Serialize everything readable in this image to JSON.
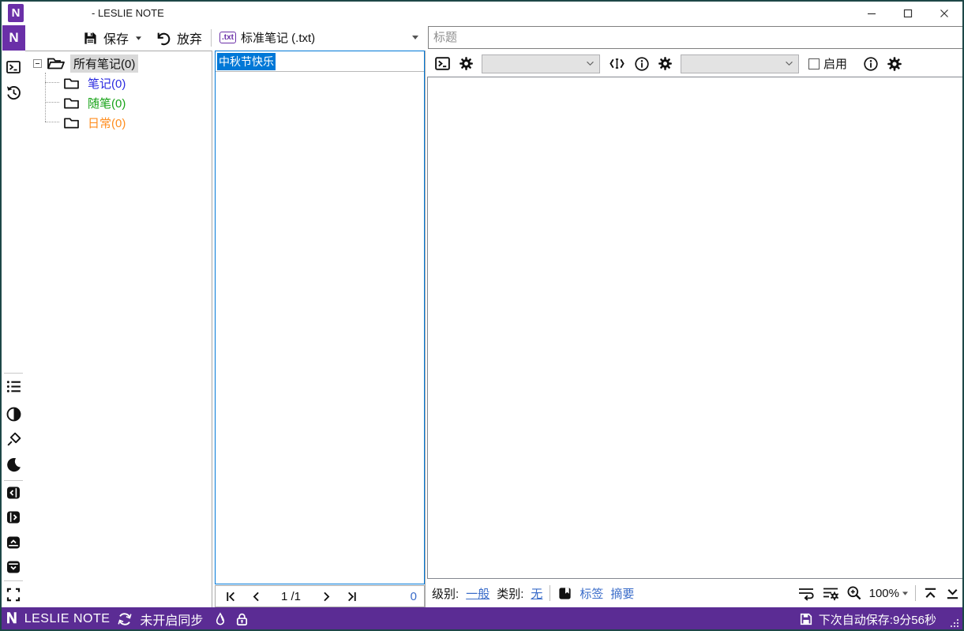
{
  "window": {
    "title": "- LESLIE NOTE"
  },
  "colors": {
    "accent_purple": "#6a2fa8",
    "statusbar_purple": "#5b2c94",
    "selection_blue": "#0078d7",
    "link_blue": "#3a6cc9",
    "folder_blue": "#2a2ae0",
    "folder_green": "#17a317",
    "folder_orange": "#ff8d1e"
  },
  "toolbar": {
    "save_label": "保存",
    "discard_label": "放弃",
    "note_type_label": "标准笔记 (.txt)",
    "txt_badge": ".txt"
  },
  "tree": {
    "items": [
      {
        "label": "所有笔记(0)"
      },
      {
        "label": "笔记(0)"
      },
      {
        "label": "随笔(0)"
      },
      {
        "label": "日常(0)"
      }
    ]
  },
  "note_list": {
    "selected_title": "中秋节快乐",
    "page_display": "1 /1",
    "count": "0"
  },
  "editor": {
    "title_placeholder": "标题",
    "enable_label": "启用"
  },
  "editor_footer": {
    "level_label": "级别:",
    "level_value": "一般",
    "category_label": "类别:",
    "category_value": "无",
    "tags_label": "标签",
    "summary_label": "摘要",
    "zoom_value": "100%"
  },
  "statusbar": {
    "logo_letter": "N",
    "app_name": "LESLIE NOTE",
    "sync_status": "未开启同步",
    "autosave": "下次自动保存:9分56秒"
  }
}
